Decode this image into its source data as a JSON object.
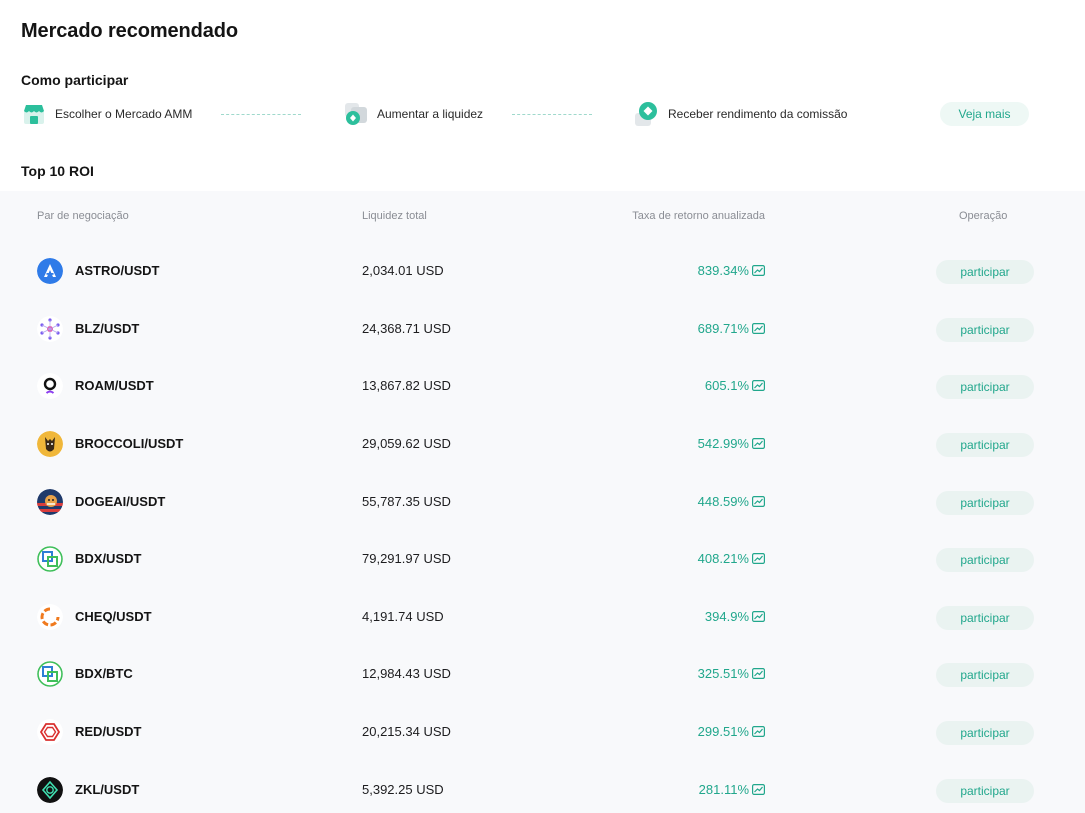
{
  "page_title": "Mercado recomendado",
  "how_to": {
    "title": "Como participar",
    "steps": [
      {
        "label": "Escolher o Mercado AMM",
        "icon": "store-icon"
      },
      {
        "label": "Aumentar a liquidez",
        "icon": "add-liquidity-icon"
      },
      {
        "label": "Receber rendimento da comissão",
        "icon": "commission-income-icon"
      }
    ],
    "see_more_label": "Veja mais"
  },
  "top_roi": {
    "title": "Top 10 ROI",
    "columns": [
      "Par de negociação",
      "Liquidez total",
      "Taxa de retorno anualizada",
      "Operação"
    ],
    "join_label": "participar",
    "rows": [
      {
        "pair": "ASTRO/USDT",
        "liquidity": "2,034.01 USD",
        "roi": "839.34%",
        "icon": "astro-coin-icon"
      },
      {
        "pair": "BLZ/USDT",
        "liquidity": "24,368.71 USD",
        "roi": "689.71%",
        "icon": "blz-coin-icon"
      },
      {
        "pair": "ROAM/USDT",
        "liquidity": "13,867.82 USD",
        "roi": "605.1%",
        "icon": "roam-coin-icon"
      },
      {
        "pair": "BROCCOLI/USDT",
        "liquidity": "29,059.62 USD",
        "roi": "542.99%",
        "icon": "broccoli-coin-icon"
      },
      {
        "pair": "DOGEAI/USDT",
        "liquidity": "55,787.35 USD",
        "roi": "448.59%",
        "icon": "dogeai-coin-icon"
      },
      {
        "pair": "BDX/USDT",
        "liquidity": "79,291.97 USD",
        "roi": "408.21%",
        "icon": "bdx-coin-icon"
      },
      {
        "pair": "CHEQ/USDT",
        "liquidity": "4,191.74 USD",
        "roi": "394.9%",
        "icon": "cheq-coin-icon"
      },
      {
        "pair": "BDX/BTC",
        "liquidity": "12,984.43 USD",
        "roi": "325.51%",
        "icon": "bdx-coin-icon"
      },
      {
        "pair": "RED/USDT",
        "liquidity": "20,215.34 USD",
        "roi": "299.51%",
        "icon": "red-coin-icon"
      },
      {
        "pair": "ZKL/USDT",
        "liquidity": "5,392.25 USD",
        "roi": "281.11%",
        "icon": "zkl-coin-icon"
      }
    ]
  },
  "colors": {
    "accent": "#21a78c",
    "panel_bg": "#f8f9fb",
    "button_bg": "#eaf3f1"
  }
}
